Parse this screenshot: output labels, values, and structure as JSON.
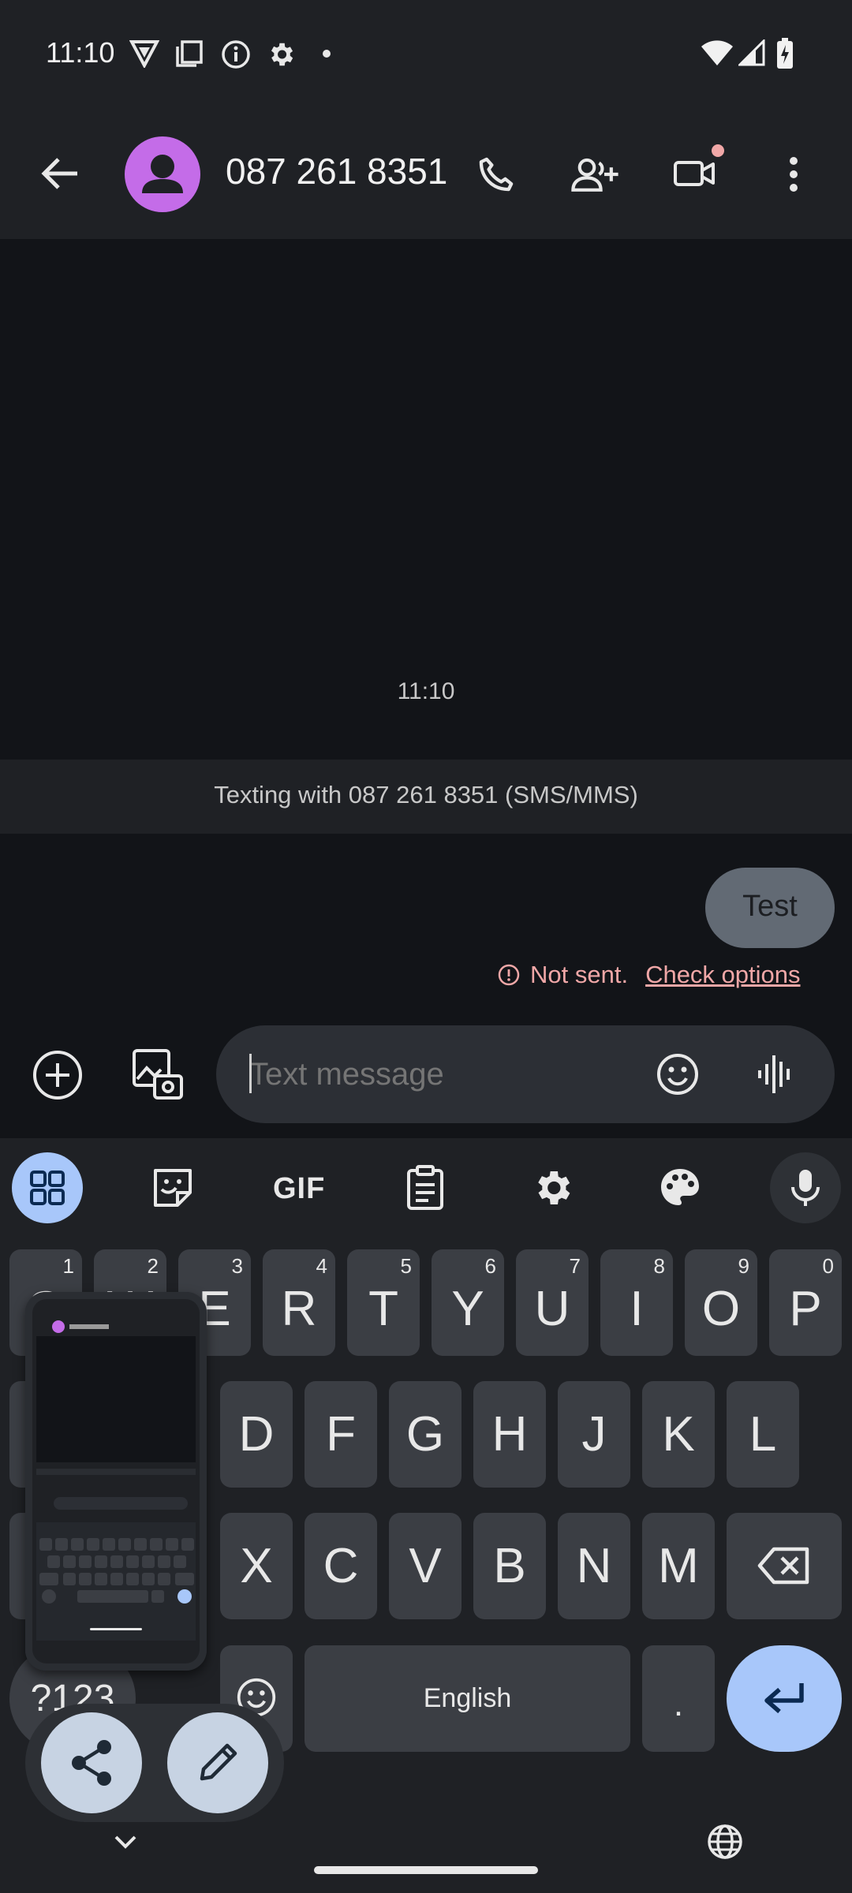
{
  "status_bar": {
    "time": "11:10",
    "icons": [
      "vpn-icon",
      "copy-icon",
      "info-icon",
      "settings-icon",
      "dot-icon",
      "wifi-icon",
      "signal-icon",
      "battery-charging-icon"
    ]
  },
  "app_bar": {
    "contact_title": "087 261 8351",
    "actions": [
      "phone-icon",
      "add-person-icon",
      "video-call-icon",
      "more-vert-icon"
    ]
  },
  "conversation": {
    "timestamp": "11:10",
    "texting_with": "Texting with 087 261 8351 (SMS/MMS)",
    "outgoing_message": "Test",
    "error_text": "Not sent.",
    "error_link": "Check options"
  },
  "composer": {
    "placeholder": "Text message"
  },
  "keyboard": {
    "toolbar": [
      "apps-grid-icon",
      "sticker-icon",
      "GIF",
      "clipboard-icon",
      "gear-icon",
      "palette-icon",
      "mic-icon"
    ],
    "gif_label": "GIF",
    "row1": [
      {
        "label": "Q",
        "hint": "1"
      },
      {
        "label": "W",
        "hint": "2"
      },
      {
        "label": "E",
        "hint": "3"
      },
      {
        "label": "R",
        "hint": "4"
      },
      {
        "label": "T",
        "hint": "5"
      },
      {
        "label": "Y",
        "hint": "6"
      },
      {
        "label": "U",
        "hint": "7"
      },
      {
        "label": "I",
        "hint": "8"
      },
      {
        "label": "O",
        "hint": "9"
      },
      {
        "label": "P",
        "hint": "0"
      }
    ],
    "row2": [
      "D",
      "F",
      "G",
      "H",
      "J",
      "K",
      "L"
    ],
    "row3": [
      "X",
      "C",
      "V",
      "B",
      "N",
      "M"
    ],
    "symbols_label": "?123",
    "space_label": "English",
    "period_label": "."
  },
  "colors": {
    "accent": "#a8c7fa",
    "avatar": "#c46ce8",
    "error": "#f0a7a7"
  }
}
